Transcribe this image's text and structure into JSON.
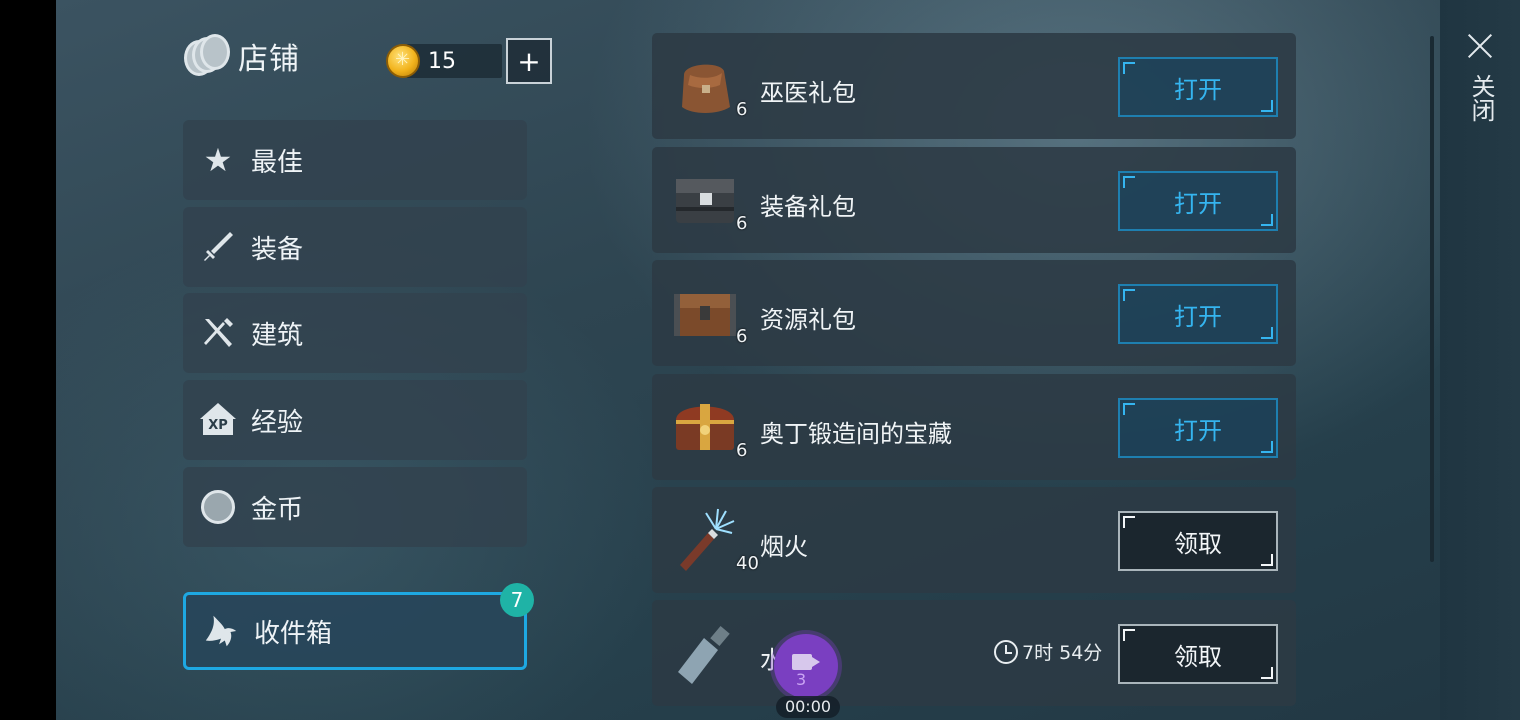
{
  "header": {
    "title": "店铺",
    "coins": "15",
    "add_label": "+"
  },
  "menu": [
    {
      "label": "最佳",
      "icon": "star-icon"
    },
    {
      "label": "装备",
      "icon": "sword-icon"
    },
    {
      "label": "建筑",
      "icon": "crossed-tools-icon"
    },
    {
      "label": "经验",
      "icon": "xp-icon",
      "icon_text": "XP"
    },
    {
      "label": "金币",
      "icon": "coin-icon"
    }
  ],
  "inbox": {
    "label": "收件箱",
    "badge": "7",
    "icon": "raven-icon"
  },
  "items": [
    {
      "name": "巫医礼包",
      "qty": "6",
      "button": "打开",
      "thumb": "leather-bag-icon"
    },
    {
      "name": "装备礼包",
      "qty": "6",
      "button": "打开",
      "thumb": "iron-chest-icon"
    },
    {
      "name": "资源礼包",
      "qty": "6",
      "button": "打开",
      "thumb": "wooden-chest-icon"
    },
    {
      "name": "奥丁锻造间的宝藏",
      "qty": "6",
      "button": "打开",
      "thumb": "treasure-chest-icon"
    },
    {
      "name": "烟火",
      "qty": "40",
      "button": "领取",
      "thumb": "firework-icon"
    },
    {
      "name": "水瓶",
      "qty": "",
      "button": "领取",
      "thumb": "water-flask-icon",
      "timer": "7时 54分"
    }
  ],
  "close": {
    "label": "关闭"
  },
  "recorder": {
    "count": "3",
    "time": "00:00"
  },
  "colors": {
    "accent_blue": "#1ea8e2",
    "open_text": "#35b5f0",
    "badge_teal": "#1fb3a6",
    "recorder_purple": "#7a3fc1"
  }
}
